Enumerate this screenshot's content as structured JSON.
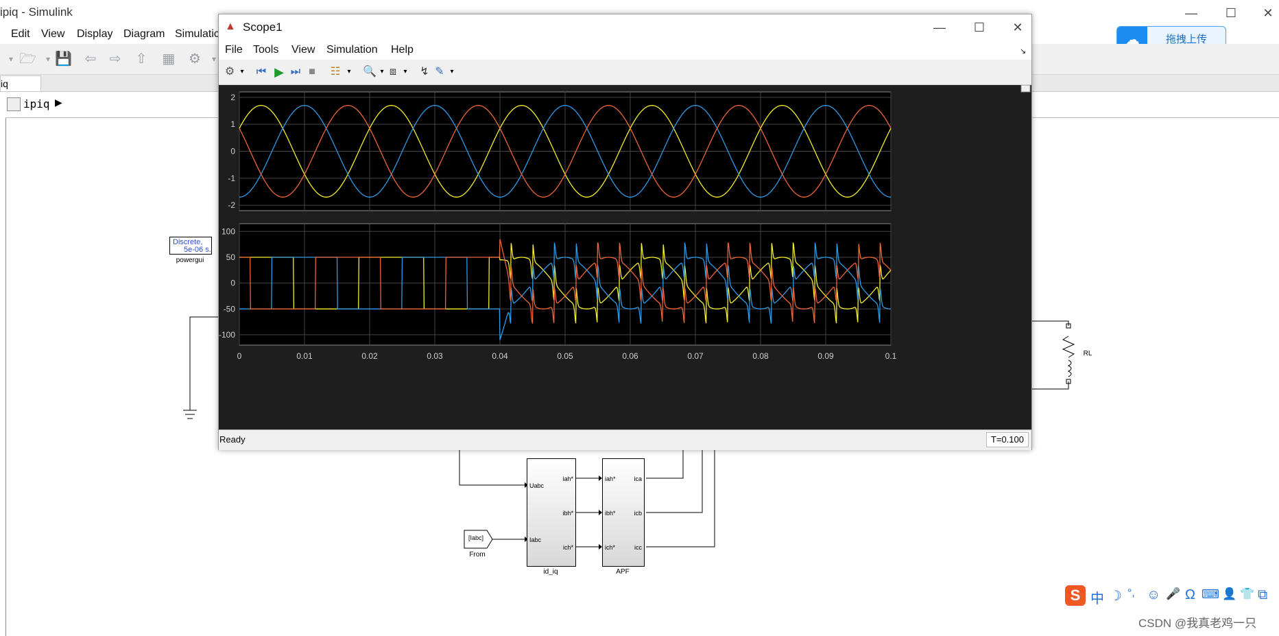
{
  "simulink": {
    "title": "ipiq - Simulink",
    "menu": [
      "Edit",
      "View",
      "Display",
      "Diagram",
      "Simulatic"
    ],
    "tab_label": "iq",
    "breadcrumb": "ipiq",
    "blocks": {
      "powergui_line1": "Discrete,",
      "powergui_line2": "5e-06 s.",
      "powergui_label": "powergui",
      "idiq_label": "id_iq",
      "idiq_in1": "Uabc",
      "idiq_in2": "Iabc",
      "idiq_out1": "iah*",
      "idiq_out2": "ibh*",
      "idiq_out3": "ich*",
      "apf_label": "APF",
      "apf_in1": "iah*",
      "apf_in2": "ibh*",
      "apf_in3": "ich*",
      "apf_out1": "ica",
      "apf_out2": "icb",
      "apf_out3": "icc",
      "from_tag": "[Iabc]",
      "from_label": "From",
      "rl_label": "RL"
    }
  },
  "baidu": {
    "label": "拖拽上传"
  },
  "ime": {
    "items": [
      "中",
      "☽",
      "°,",
      "☺",
      "🎤",
      "Ω",
      "⌨",
      "👤",
      "👕",
      "⧉"
    ]
  },
  "watermark": "CSDN @我真老鸡一只",
  "scope": {
    "title": "Scope1",
    "menu": [
      "File",
      "Tools",
      "View",
      "Simulation",
      "Help"
    ],
    "status": "Ready",
    "time": "T=0.100"
  },
  "colors": {
    "series_a": "#f5ef2b",
    "series_b": "#2f9be6",
    "series_c": "#f0643a",
    "plot_bg": "#000000"
  },
  "chart_data": [
    {
      "type": "line",
      "title": "",
      "xlabel": "",
      "ylabel": "",
      "xlim": [
        0,
        0.1
      ],
      "ylim": [
        -2.2,
        2.2
      ],
      "yticks": [
        2,
        1,
        0,
        -1,
        -2
      ],
      "grid": true,
      "series": [
        {
          "color": "#f5ef2b",
          "amplitude": 1.7,
          "frequency_hz": 50,
          "phase_deg": 30
        },
        {
          "color": "#2f9be6",
          "amplitude": 1.7,
          "frequency_hz": 50,
          "phase_deg": -90
        },
        {
          "color": "#f0643a",
          "amplitude": 1.7,
          "frequency_hz": 50,
          "phase_deg": 150
        }
      ]
    },
    {
      "type": "line",
      "title": "",
      "xlabel": "",
      "ylabel": "",
      "xlim": [
        0,
        0.1
      ],
      "ylim": [
        -120,
        115
      ],
      "yticks": [
        100,
        50,
        0,
        -50,
        -100
      ],
      "xticks": [
        0,
        0.01,
        0.02,
        0.03,
        0.04,
        0.05,
        0.06,
        0.07,
        0.08,
        0.09,
        0.1
      ],
      "xticklabels": [
        "0",
        "0.01",
        "0.02",
        "0.03",
        "0.04",
        "0.05",
        "0.06",
        "0.07",
        "0.08",
        "0.09",
        "0.1"
      ],
      "grid": true,
      "switch_time": 0.04,
      "series": [
        {
          "color": "#f5ef2b",
          "pre_amplitude": 50,
          "post_amplitude": 50,
          "phase_deg": 30
        },
        {
          "color": "#2f9be6",
          "pre_amplitude": 50,
          "post_amplitude": 50,
          "phase_deg": -90
        },
        {
          "color": "#f0643a",
          "pre_amplitude": 50,
          "post_amplitude": 50,
          "phase_deg": 150
        }
      ]
    }
  ]
}
